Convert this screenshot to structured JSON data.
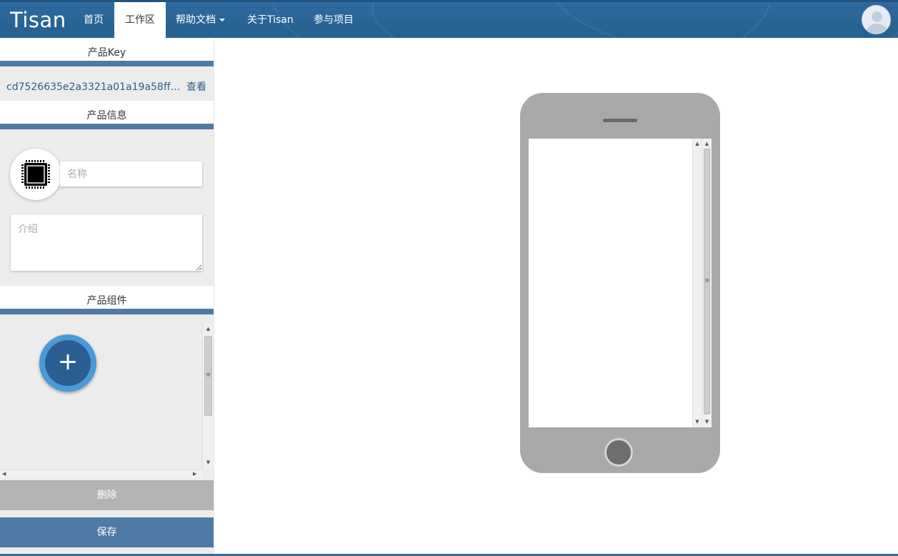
{
  "navbar": {
    "brand": "Tisan",
    "items": [
      {
        "label": "首页"
      },
      {
        "label": "工作区"
      },
      {
        "label": "帮助文档"
      },
      {
        "label": "关于Tisan"
      },
      {
        "label": "参与项目"
      }
    ],
    "active_item": "工作区",
    "avatar_icon": "user-avatar-icon"
  },
  "sidebar": {
    "product_key": {
      "title": "产品Key",
      "value": "cd7526635e2a3321a01a19a58ffae4...",
      "view_link": "查看"
    },
    "product_info": {
      "title": "产品信息",
      "icon": "chip-icon",
      "name_placeholder": "名称",
      "name_value": "",
      "intro_placeholder": "介绍",
      "intro_value": ""
    },
    "components": {
      "title": "产品组件",
      "add_label": "+"
    },
    "delete_label": "删除",
    "save_label": "保存"
  },
  "colors": {
    "navbar": "#2e6aa0",
    "section_bar": "#4e7ba5",
    "save_button": "#4e7ba5",
    "delete_button": "#b3b3b3",
    "add_button_outer": "#4a9ad6",
    "add_button_inner": "#2b5f93",
    "phone_body": "#a9a9a9"
  }
}
